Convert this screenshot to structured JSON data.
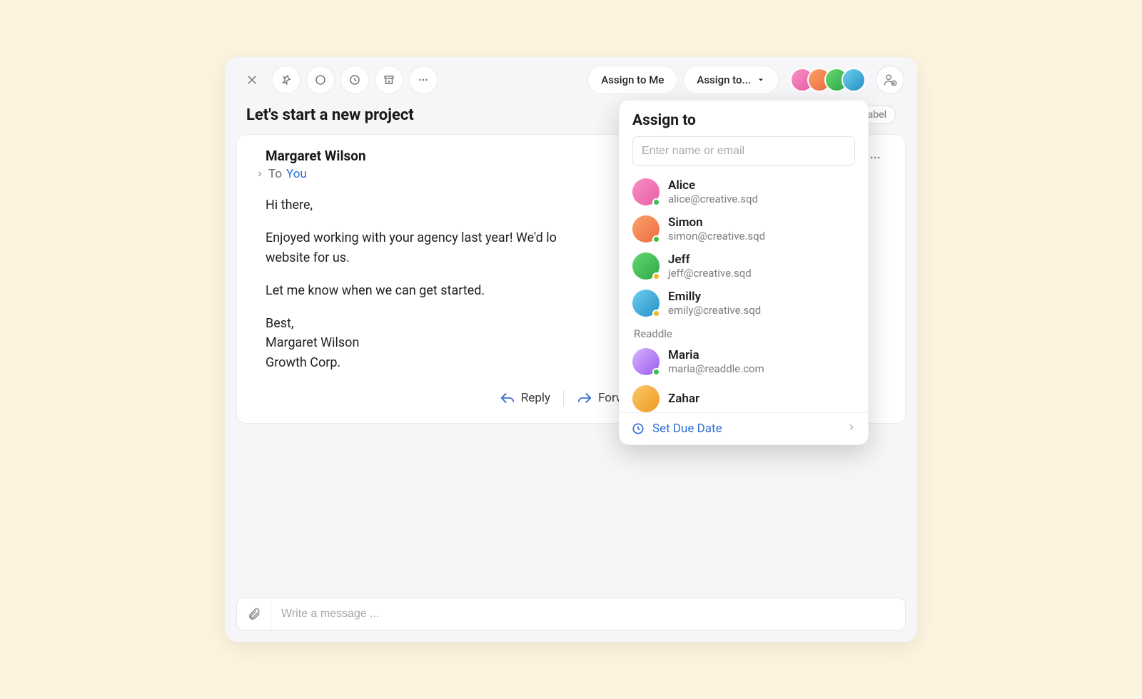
{
  "toolbar": {
    "assign_to_me_label": "Assign to Me",
    "assign_to_label": "Assign to..."
  },
  "subject": "Let's start a new project",
  "label_chip": "label",
  "message": {
    "sender": "Margaret Wilson",
    "to_label": "To",
    "to_value": "You",
    "body_greeting": "Hi there,",
    "body_p1_visible": "Enjoyed working with your agency last year! We'd lo",
    "body_p1_line2": "website for us.",
    "body_p2": "Let me know when we can get started.",
    "body_closing1": "Best,",
    "body_closing2": "Margaret Wilson",
    "body_closing3": "Growth Corp."
  },
  "actions": {
    "reply_label": "Reply",
    "forward_label": "Forward"
  },
  "popover": {
    "title": "Assign to",
    "search_placeholder": "Enter name or email",
    "group1": [
      {
        "name": "Alice",
        "email": "alice@creative.sqd",
        "avatar": "g1",
        "status": "dot-green"
      },
      {
        "name": "Simon",
        "email": "simon@creative.sqd",
        "avatar": "g2",
        "status": "dot-green"
      },
      {
        "name": "Jeff",
        "email": "jeff@creative.sqd",
        "avatar": "g3",
        "status": "dot-yellow"
      },
      {
        "name": "Emilly",
        "email": "emily@creative.sqd",
        "avatar": "g4",
        "status": "dot-yellow"
      }
    ],
    "group2_label": "Readdle",
    "group2": [
      {
        "name": "Maria",
        "email": "maria@readdle.com",
        "avatar": "g5",
        "status": "dot-green"
      },
      {
        "name": "Zahar",
        "email": "",
        "avatar": "g6",
        "status": ""
      }
    ],
    "set_due_date_label": "Set Due Date"
  },
  "compose": {
    "placeholder": "Write a message ..."
  },
  "header_avatars": [
    "g1",
    "g2",
    "g3",
    "g4"
  ]
}
